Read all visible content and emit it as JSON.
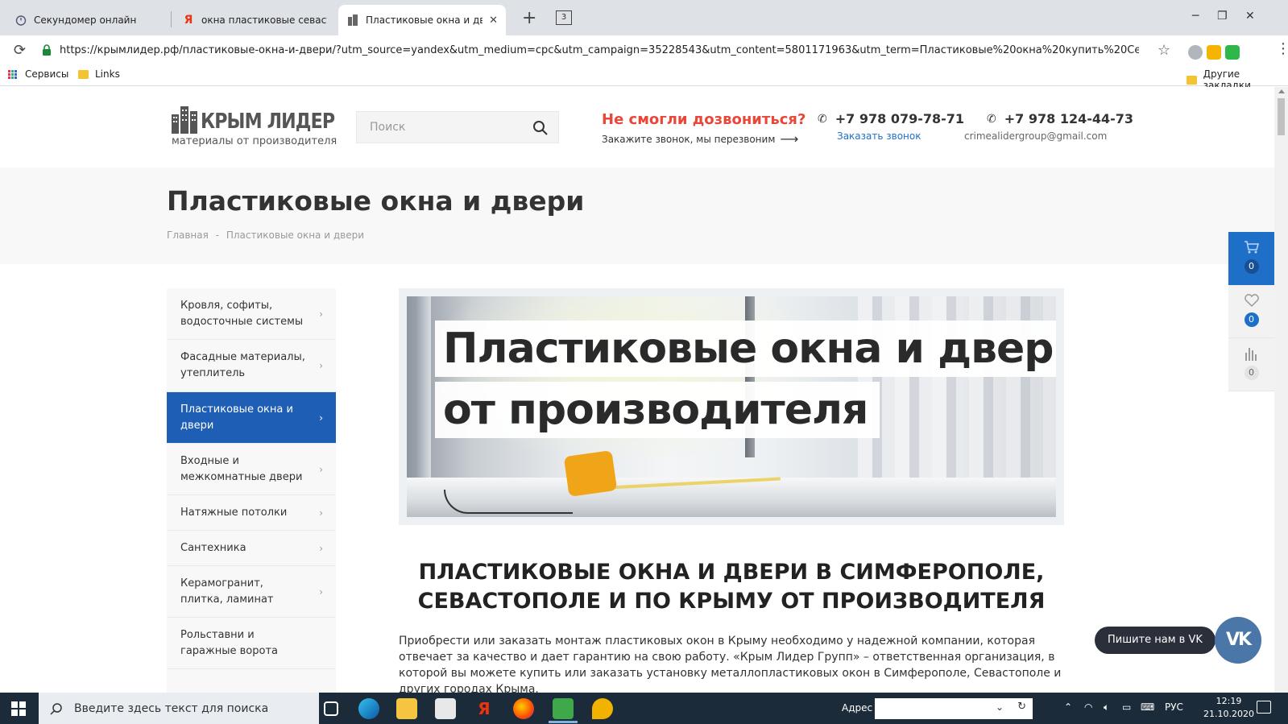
{
  "browser": {
    "tabs": [
      {
        "title": "Секундомер онлайн",
        "active": false
      },
      {
        "title": "окна пластиковые севастопол",
        "active": false
      },
      {
        "title": "Пластиковые окна и двери",
        "active": true
      }
    ],
    "tab_count": "3",
    "url": "https://крымлидер.рф/пластиковые-окна-и-двери/?utm_source=yandex&utm_medium=cpc&utm_campaign=35228543&utm_content=5801171963&utm_term=Пластиковые%20окна%20купить%20Севастополь&...",
    "bookmarks": {
      "apps_label": "Сервисы",
      "links_label": "Links",
      "other_label": "Другие закладки"
    }
  },
  "header": {
    "logo_title": "КРЫМ ЛИДЕР",
    "logo_subtitle": "материалы от производителя",
    "search_placeholder": "Поиск",
    "callback_title": "Не смогли дозвониться?",
    "callback_sub": "Закажите звонок, мы перезвоним",
    "phone1": "+7 978 079-78-71",
    "phone1_sub": "Заказать звонок",
    "phone2": "+7 978 124-44-73",
    "phone2_sub": "crimealidergroup@gmail.com"
  },
  "page": {
    "title": "Пластиковые окна и двери",
    "breadcrumb_home": "Главная",
    "breadcrumb_sep": "-",
    "breadcrumb_current": "Пластиковые окна и двери"
  },
  "sidebar": {
    "items": [
      {
        "label": "Кровля, софиты, водосточные системы",
        "active": false
      },
      {
        "label": "Фасадные материалы, утеплитель",
        "active": false
      },
      {
        "label": "Пластиковые окна и двери",
        "active": true
      },
      {
        "label": "Входные и межкомнатные двери",
        "active": false
      },
      {
        "label": "Натяжные потолки",
        "active": false
      },
      {
        "label": "Сантехника",
        "active": false
      },
      {
        "label": "Керамогранит, плитка, ламинат",
        "active": false
      },
      {
        "label": "Рольставни и гаражные ворота",
        "active": false
      }
    ]
  },
  "banner": {
    "line1": "Пластиковые окна и двери",
    "line2": "от производителя"
  },
  "content": {
    "heading": "ПЛАСТИКОВЫЕ ОКНА И ДВЕРИ В СИМФЕРОПОЛЕ, СЕВАСТОПОЛЕ И ПО КРЫМУ ОТ ПРОИЗВОДИТЕЛЯ",
    "intro": "Приобрести или заказать монтаж пластиковых окон в Крыму необходимо у надежной компании, которая отвечает за качество и дает гарантию на свою работу. «Крым Лидер Групп» – ответственная организация, в которой вы можете купить или заказать установку металлопластиковых окон в Симферополе, Севастополе и других городах Крыма."
  },
  "widgets": {
    "cart_count": "0",
    "favorites_count": "0",
    "compare_count": "0",
    "vk_label": "Пишите нам в VK",
    "vk_logo": "VK"
  },
  "taskbar": {
    "search_placeholder": "Введите здесь текст для поиска",
    "address_label": "Адрес",
    "lang": "РУС",
    "time": "12:19",
    "date": "21.10.2020"
  },
  "colors": {
    "accent_blue": "#1e5eb5",
    "callback_red": "#e8473a",
    "link_blue": "#1e6fc8"
  }
}
